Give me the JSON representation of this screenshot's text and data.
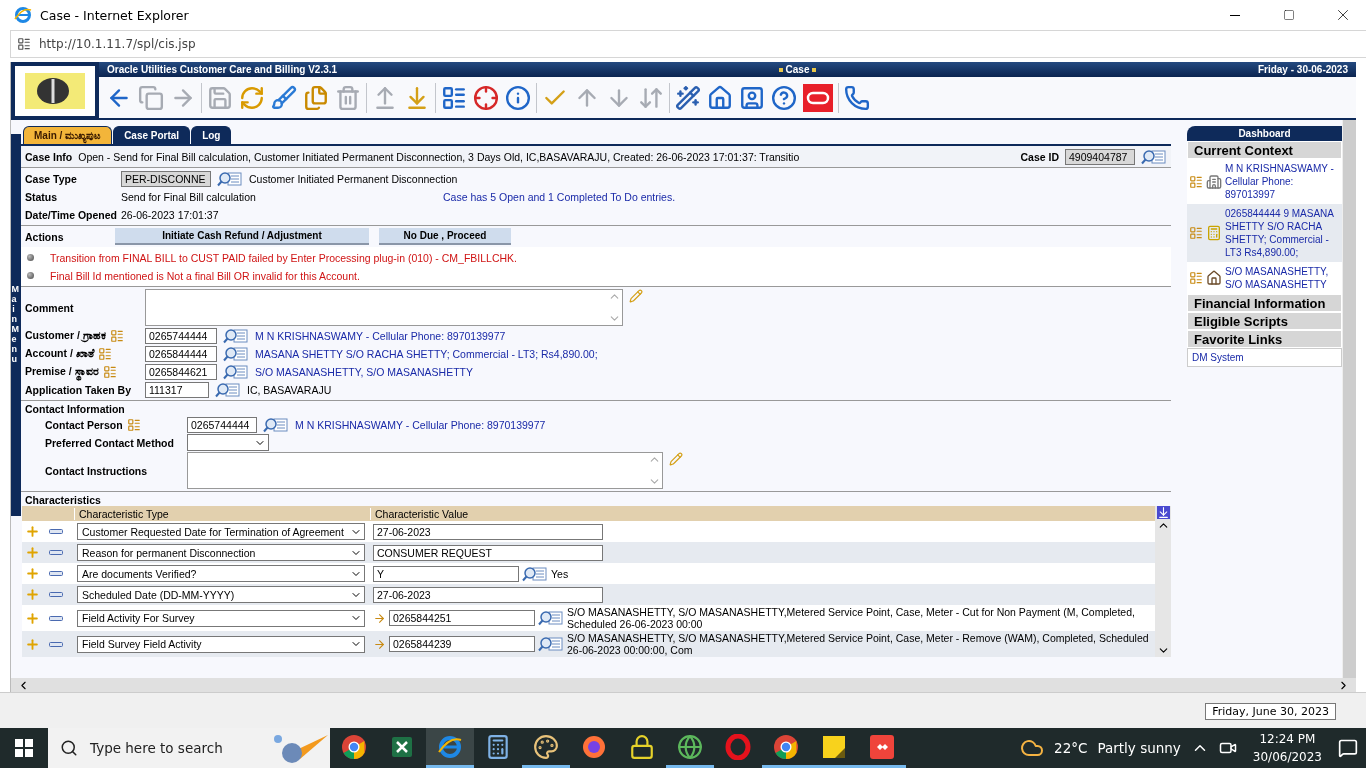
{
  "window": {
    "title": "Case - Internet Explorer",
    "address": "http://10.1.11.7/spl/cis.jsp"
  },
  "app": {
    "product": "Oracle Utilities Customer Care and Billing V2.3.1",
    "page": "Case",
    "date": "Friday - 30-06-2023",
    "side_menu": "Main Menu"
  },
  "toolbar": [
    {
      "kind": "back",
      "disabled": false
    },
    {
      "kind": "copy",
      "disabled": true
    },
    {
      "kind": "forward",
      "disabled": true
    },
    {
      "kind": "separator"
    },
    {
      "kind": "save",
      "disabled": true
    },
    {
      "kind": "refresh",
      "disabled": false
    },
    {
      "kind": "clear",
      "disabled": false
    },
    {
      "kind": "duplicate",
      "disabled": false
    },
    {
      "kind": "delete",
      "disabled": true
    },
    {
      "kind": "separator"
    },
    {
      "kind": "go-up",
      "disabled": true
    },
    {
      "kind": "go-down",
      "disabled": false
    },
    {
      "kind": "separator"
    },
    {
      "kind": "context",
      "disabled": false
    },
    {
      "kind": "target",
      "disabled": false
    },
    {
      "kind": "info",
      "disabled": false
    },
    {
      "kind": "separator"
    },
    {
      "kind": "check",
      "disabled": false
    },
    {
      "kind": "up",
      "disabled": true
    },
    {
      "kind": "down",
      "disabled": true
    },
    {
      "kind": "updown",
      "disabled": true
    },
    {
      "kind": "separator"
    },
    {
      "kind": "wand",
      "disabled": false
    },
    {
      "kind": "home",
      "disabled": false
    },
    {
      "kind": "user",
      "disabled": false
    },
    {
      "kind": "help",
      "disabled": false
    },
    {
      "kind": "oracle",
      "disabled": false
    },
    {
      "kind": "separator"
    },
    {
      "kind": "phone",
      "disabled": false
    }
  ],
  "tabs": [
    {
      "label": "Main / ಮುಖ್ಯಪುಟ",
      "selected": true
    },
    {
      "label": "Case Portal",
      "selected": false
    },
    {
      "label": "Log",
      "selected": false
    }
  ],
  "case_info": {
    "label": "Case Info",
    "text": "Open - Send for Final Bill calculation, Customer Initiated Permanent Disconnection, 3 Days Old, IC,BASAVARAJU, Created: 26-06-2023 17:01:37: Transitio",
    "id_label": "Case ID",
    "case_id": "4909404787"
  },
  "summary": {
    "case_type_label": "Case Type",
    "case_type": "PER-DISCONNE",
    "case_type_desc": "Customer Initiated Permanent Disconnection",
    "status_label": "Status",
    "status": "Send for Final Bill calculation",
    "todo_note": "Case has 5 Open and 1 Completed To Do entries.",
    "opened_label": "Date/Time Opened",
    "opened": "26-06-2023 17:01:37"
  },
  "actions": {
    "label": "Actions",
    "buttons": [
      "Initiate Cash Refund / Adjustment",
      "No Due , Proceed"
    ]
  },
  "messages": [
    "Transition from FINAL BILL to CUST PAID failed by Enter Processing plug-in (010) - CM_FBILLCHK.",
    "Final Bill Id mentioned is Not a final Bill OR invalid for this Account."
  ],
  "comment": {
    "label": "Comment"
  },
  "links": [
    {
      "label": "Customer / ಗ್ರಾಹಕ",
      "context_menu": true,
      "value": "0265744444",
      "kind": "link",
      "desc": "M N KRISHNASWAMY -  Cellular Phone:  8970139977"
    },
    {
      "label": "Account / ಖಾತೆ",
      "context_menu": true,
      "value": "0265844444",
      "kind": "link",
      "desc": "MASANA SHETTY S/O RACHA SHETTY; Commercial - LT3; Rs4,890.00;"
    },
    {
      "label": "Premise / ಸ್ಥಾವರ",
      "context_menu": true,
      "value": "0265844621",
      "kind": "link",
      "desc": "S/O MASANASHETTY, S/O MASANASHETTY"
    },
    {
      "label": "Application Taken By",
      "context_menu": false,
      "value": "111317",
      "kind": "plain",
      "desc": "IC, BASAVARAJU"
    }
  ],
  "contact": {
    "title": "Contact Information",
    "person_label": "Contact Person",
    "person": "0265744444",
    "person_desc": "M N KRISHNASWAMY -  Cellular Phone:  8970139977",
    "method_label": "Preferred Contact Method",
    "instructions_label": "Contact Instructions"
  },
  "characteristics": {
    "title": "Characteristics",
    "columns": [
      "Characteristic Type",
      "Characteristic Value"
    ],
    "rows": [
      {
        "kind": "text",
        "type": "Customer Requested Date for Termination of Agreement",
        "value": "27-06-2023"
      },
      {
        "kind": "text",
        "type": "Reason for permanent Disconnection",
        "value": "CONSUMER REQUEST"
      },
      {
        "kind": "lookup",
        "type": "Are documents Verified?",
        "value": "Y",
        "desc": "Yes"
      },
      {
        "kind": "text",
        "type": "Scheduled Date (DD-MM-YYYY)",
        "value": "27-06-2023"
      },
      {
        "kind": "fk",
        "type": "Field Activity  For Survey",
        "value": "0265844251",
        "desc": "S/O MASANASHETTY, S/O MASANASHETTY,Metered Service Point, Case, Meter - Cut for Non Payment (M, Completed, Scheduled 26-06-2023 00:00"
      },
      {
        "kind": "fk",
        "type": "Field Survey Field Activity",
        "value": "0265844239",
        "desc": "S/O MASANASHETTY, S/O MASANASHETTY,Metered Service Point, Case, Meter - Remove (WAM), Completed, Scheduled 26-06-2023 00:00:00, Com"
      }
    ]
  },
  "dashboard": {
    "title": "Dashboard",
    "context_title": "Current Context",
    "context": [
      {
        "kind": "person",
        "text": "M N KRISHNASWAMY - Cellular Phone: 897013997"
      },
      {
        "kind": "account",
        "text": "0265844444 9 MASANA SHETTY S/O RACHA SHETTY; Commercial - LT3 Rs4,890.00;"
      },
      {
        "kind": "premise",
        "text": "S/O MASANASHETTY, S/O MASANASHETTY"
      }
    ],
    "sections": [
      "Financial Information",
      "Eligible Scripts"
    ],
    "favorites_title": "Favorite Links",
    "favorites": [
      "DM System"
    ]
  },
  "status_bar": {
    "tooltip": "Friday, June 30, 2023"
  },
  "taskbar": {
    "search_placeholder": "Type here to search",
    "apps": [
      {
        "kind": "chrome",
        "open": false,
        "selected": false
      },
      {
        "kind": "excel",
        "open": false,
        "selected": false
      },
      {
        "kind": "ie",
        "open": true,
        "selected": true
      },
      {
        "kind": "calculator",
        "open": false,
        "selected": false
      },
      {
        "kind": "paint",
        "open": true,
        "selected": false
      },
      {
        "kind": "firefox",
        "open": false,
        "selected": false
      },
      {
        "kind": "vpn",
        "open": false,
        "selected": false
      },
      {
        "kind": "globe",
        "open": true,
        "selected": false
      },
      {
        "kind": "opera",
        "open": false,
        "selected": false
      },
      {
        "kind": "chrome",
        "open": true,
        "selected": false
      },
      {
        "kind": "sticky",
        "open": true,
        "selected": false
      },
      {
        "kind": "remote",
        "open": true,
        "selected": false
      }
    ],
    "temperature": "22°C",
    "weather": "Partly sunny",
    "time": "12:24 PM",
    "date": "30/06/2023"
  }
}
